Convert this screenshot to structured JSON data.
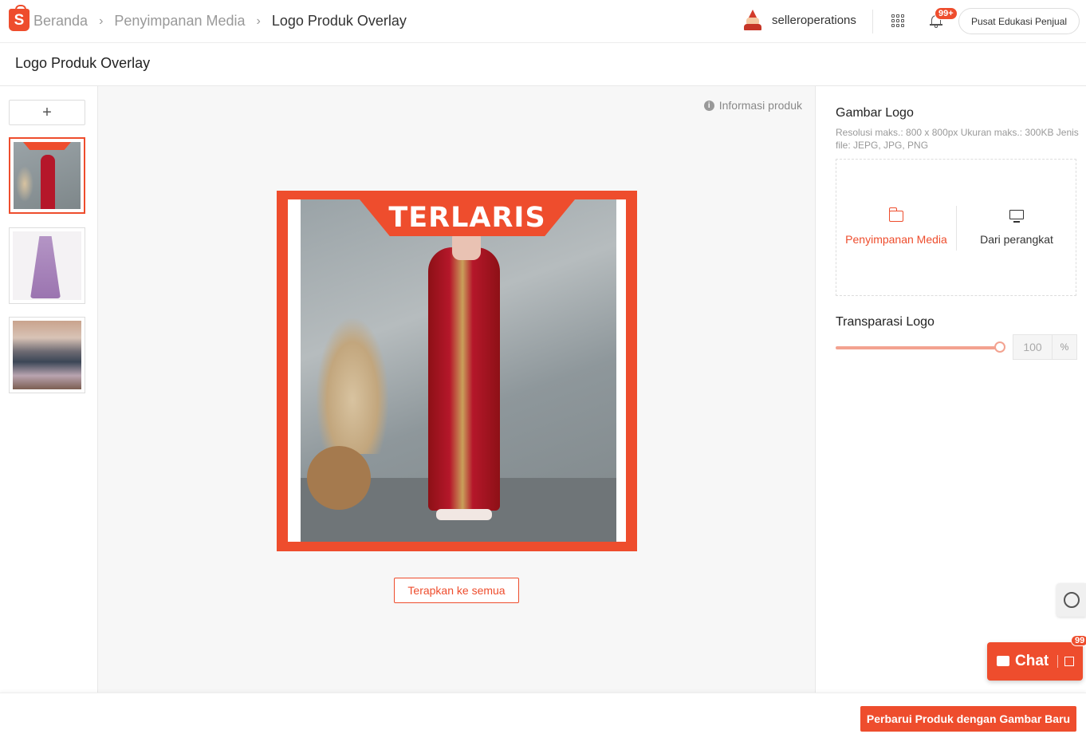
{
  "breadcrumb": {
    "home": "Beranda",
    "media": "Penyimpanan Media",
    "current": "Logo Produk Overlay"
  },
  "header": {
    "username": "selleroperations",
    "notif_badge": "99+",
    "edu_button": "Pusat Edukasi Penjual"
  },
  "page": {
    "title": "Logo Produk Overlay"
  },
  "left": {
    "add_label": "+"
  },
  "center": {
    "info_label": "Informasi produk",
    "banner_text": "TERLARIS",
    "apply_label": "Terapkan ke semua"
  },
  "right": {
    "logo_title": "Gambar Logo",
    "logo_hint": "Resolusi maks.: 800 x 800px Ukuran maks.: 300KB Jenis file: JEPG, JPG, PNG",
    "upload_media": "Penyimpanan Media",
    "upload_device": "Dari perangkat",
    "transparency_title": "Transparasi Logo",
    "transparency_value": "100",
    "transparency_unit": "%"
  },
  "footer": {
    "update_label": "Perbarui Produk dengan Gambar Baru"
  },
  "chat": {
    "label": "Chat",
    "badge": "99"
  },
  "colors": {
    "accent": "#ee4d2d"
  }
}
